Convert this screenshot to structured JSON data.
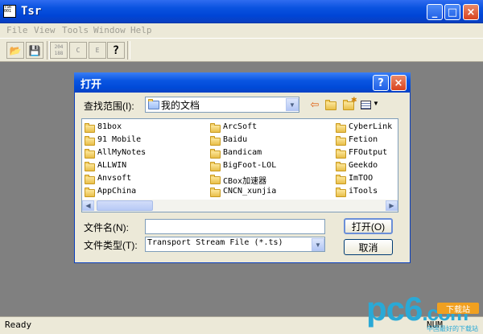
{
  "window": {
    "title": "Tsr",
    "icon": "app-icon",
    "icon_text": "TSR\n001",
    "minimize": "_",
    "maximize": "□",
    "close": "×"
  },
  "menu": [
    {
      "label": "File",
      "key": "F"
    },
    {
      "label": "View",
      "key": "V"
    },
    {
      "label": "Tools",
      "key": "T"
    },
    {
      "label": "Window",
      "key": "W"
    },
    {
      "label": "Help",
      "key": "H"
    }
  ],
  "toolbar": [
    {
      "name": "open-folder-icon",
      "text": "📂"
    },
    {
      "name": "save-disk-icon",
      "text": "💾"
    },
    {
      "name": "convert-icon",
      "text": "204\n188"
    },
    {
      "name": "c-icon",
      "text": "C"
    },
    {
      "name": "e-icon",
      "text": "E"
    },
    {
      "name": "help-icon",
      "text": "?"
    }
  ],
  "dialog": {
    "title": "打开",
    "help": "?",
    "close": "×",
    "lookin_label": "查找范围(I):",
    "lookin_value": "我的文档",
    "filename_label": "文件名(N):",
    "filename_value": "",
    "filetype_label": "文件类型(T):",
    "filetype_value": "Transport Stream File (*.ts)",
    "open_button": "打开(O)",
    "cancel_button": "取消"
  },
  "folders": [
    [
      "81box",
      "91 Mobile",
      "AllMyNotes",
      "ALLWIN",
      "Anvsoft",
      "AppChina"
    ],
    [
      "ArcSoft",
      "Baidu",
      "Bandicam",
      "BigFoot-LOL",
      "CBox加速器",
      "CNCN_xunjia"
    ],
    [
      "CyberLink",
      "Fetion",
      "FFOutput",
      "Geekdo",
      "ImTOO",
      "iTools"
    ]
  ],
  "status": {
    "text": "Ready",
    "num": "NUM"
  },
  "watermark": {
    "brand": "pc6",
    "domain": ".com",
    "badge": "下载站",
    "slogan": "中国最好的下载站"
  },
  "colors": {
    "titlebar": "#0a53e0",
    "face": "#ece9d8",
    "desktop": "#808080",
    "watermark": "#2aa9d6"
  }
}
